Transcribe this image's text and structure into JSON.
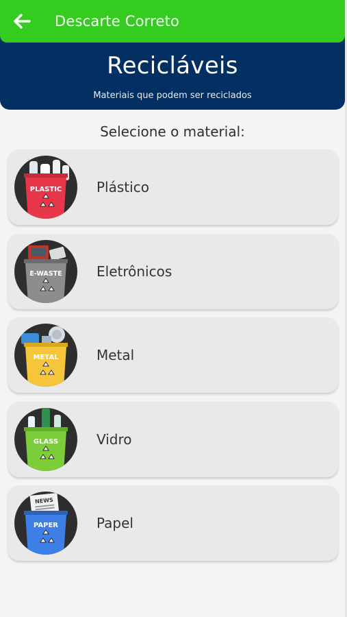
{
  "appbar": {
    "title": "Descarte Correto",
    "back_icon": "arrow-left-icon",
    "color": "#33cc1f"
  },
  "hero": {
    "title": "Recicláveis",
    "subtitle": "Materiais que podem ser reciclados",
    "color": "#023063"
  },
  "prompt": "Selecione o material:",
  "materials": [
    {
      "label": "Plástico",
      "bin_text": "PLASTIC",
      "bin_color": "#e8374a",
      "icon": "plastic-bin-icon"
    },
    {
      "label": "Eletrônicos",
      "bin_text": "E-WASTE",
      "bin_color": "#8d8d8d",
      "icon": "ewaste-bin-icon"
    },
    {
      "label": "Metal",
      "bin_text": "METAL",
      "bin_color": "#f5c63c",
      "icon": "metal-bin-icon"
    },
    {
      "label": "Vidro",
      "bin_text": "GLASS",
      "bin_color": "#7ccd3a",
      "icon": "glass-bin-icon"
    },
    {
      "label": "Papel",
      "bin_text": "PAPER",
      "bin_color": "#3d7fe6",
      "icon": "paper-bin-icon",
      "paper_text": "NEWS"
    }
  ]
}
